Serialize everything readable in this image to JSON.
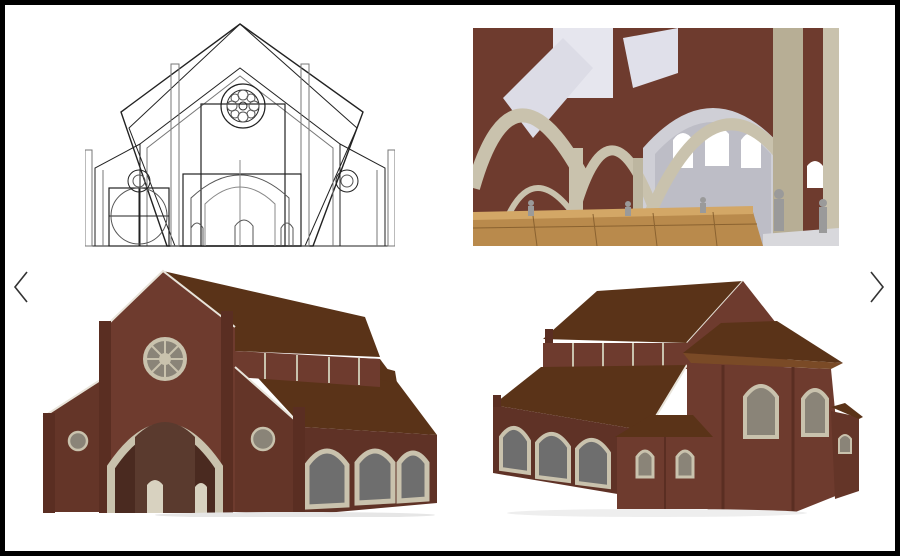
{
  "gallery": {
    "prev_icon": "chevron-left-icon",
    "next_icon": "chevron-right-icon"
  },
  "images": [
    {
      "kind": "elevation-line-drawing"
    },
    {
      "kind": "interior-render"
    },
    {
      "kind": "exterior-front-render"
    },
    {
      "kind": "exterior-rear-render"
    }
  ],
  "colors": {
    "frame": "#000000",
    "background": "#ffffff",
    "brick": "#6e3b2e",
    "brick_dark": "#4f2a20",
    "roof": "#5a3318",
    "roof_light": "#7a4a26",
    "stone": "#c9c2ad",
    "stone_dark": "#9c9580",
    "wall_light": "#d8d8dc",
    "pew": "#b98a4c",
    "sky": "#e9e9ef",
    "line": "#222222",
    "arrow": "#333333"
  }
}
